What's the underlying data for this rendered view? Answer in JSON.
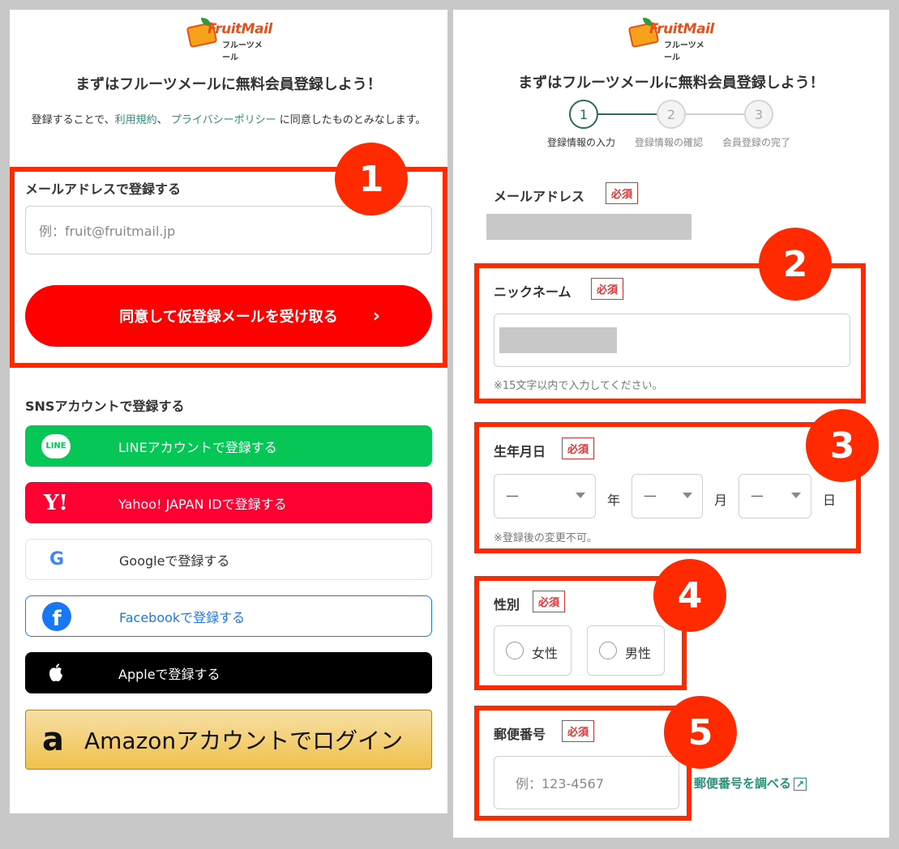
{
  "brand": {
    "logo_text": "FruitMail",
    "logo_sub": "フルーツメール"
  },
  "left": {
    "title": "まずはフルーツメールに無料会員登録しよう！",
    "consent_prefix": "登録することで、",
    "terms_link": "利用規約",
    "separator": "、",
    "privacy_link": "プライバシーポリシー",
    "consent_suffix": "に同意したものとみなします。",
    "email_label": "メールアドレスで登録する",
    "email_placeholder": "例：fruit@fruitmail.jp",
    "submit_label": "同意して仮登録メールを受け取る",
    "sns_heading": "SNSアカウントで登録する",
    "sns_buttons": [
      {
        "label": "LINEアカウントで登録する",
        "icon": "line-icon",
        "icon_text": "LINE"
      },
      {
        "label": "Yahoo! JAPAN IDで登録する",
        "icon": "yahoo-icon",
        "icon_text": "Y!"
      },
      {
        "label": "Googleで登録する",
        "icon": "google-icon",
        "icon_text": "G"
      },
      {
        "label": "Facebookで登録する",
        "icon": "facebook-icon",
        "icon_text": "f"
      },
      {
        "label": "Appleで登録する",
        "icon": "apple-icon"
      }
    ],
    "amazon_label": "Amazonアカウントでログイン",
    "amazon_icon_text": "a"
  },
  "right": {
    "title": "まずはフルーツメールに無料会員登録しよう！",
    "steps": [
      {
        "num": "1",
        "label": "登録情報の入力"
      },
      {
        "num": "2",
        "label": "登録情報の確認"
      },
      {
        "num": "3",
        "label": "会員登録の完了"
      }
    ],
    "required": "必須",
    "email_label": "メールアドレス",
    "nickname_label": "ニックネーム",
    "nickname_hint": "※15文字以内で入力してください。",
    "birth_label": "生年月日",
    "birth_year": "—",
    "birth_month": "—",
    "birth_day": "—",
    "unit_year": "年",
    "unit_month": "月",
    "unit_day": "日",
    "birth_hint": "※登録後の変更不可。",
    "gender_label": "性別",
    "gender_female": "女性",
    "gender_male": "男性",
    "postal_label": "郵便番号",
    "postal_placeholder": "例：123-4567",
    "postal_lookup": "郵便番号を調べる"
  },
  "annotations": [
    "1",
    "2",
    "3",
    "4",
    "5"
  ],
  "colors": {
    "accent_red": "#ff2a00",
    "submit_red": "#fe0000",
    "link_teal": "#2a8f7b"
  }
}
